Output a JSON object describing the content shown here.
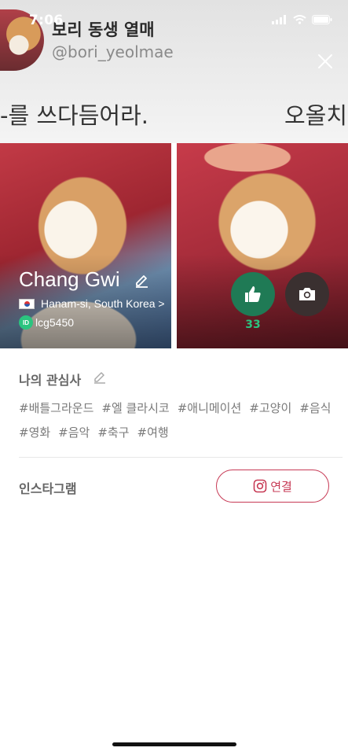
{
  "status_bar": {
    "time": "7:06"
  },
  "header": {
    "nickname": "보리 동생 열매",
    "username": "@bori_yeolmae",
    "banner_left": "-를 쓰다듬어라.",
    "banner_right": "오올치"
  },
  "profile": {
    "name": "Chang Gwi",
    "location": "Hanam-si, South Korea >",
    "id_badge": "ID",
    "user_id": "lcg5450",
    "like_count": "33"
  },
  "interests": {
    "title": "나의 관심사",
    "tags": [
      "#배틀그라운드",
      "#엘 클라시코",
      "#애니메이션",
      "#고양이",
      "#음식",
      "#영화",
      "#음악",
      "#축구",
      "#여행"
    ]
  },
  "instagram": {
    "label": "인스타그램",
    "connect_label": "연결"
  },
  "colors": {
    "accent": "#c73a55",
    "green": "#2bc47f",
    "like_bg": "#1f7a55"
  },
  "icons": [
    "wifi-icon",
    "battery-icon",
    "signal-icon",
    "close-icon",
    "pencil-icon",
    "thumbs-up-icon",
    "camera-icon",
    "instagram-icon",
    "flag-icon"
  ]
}
